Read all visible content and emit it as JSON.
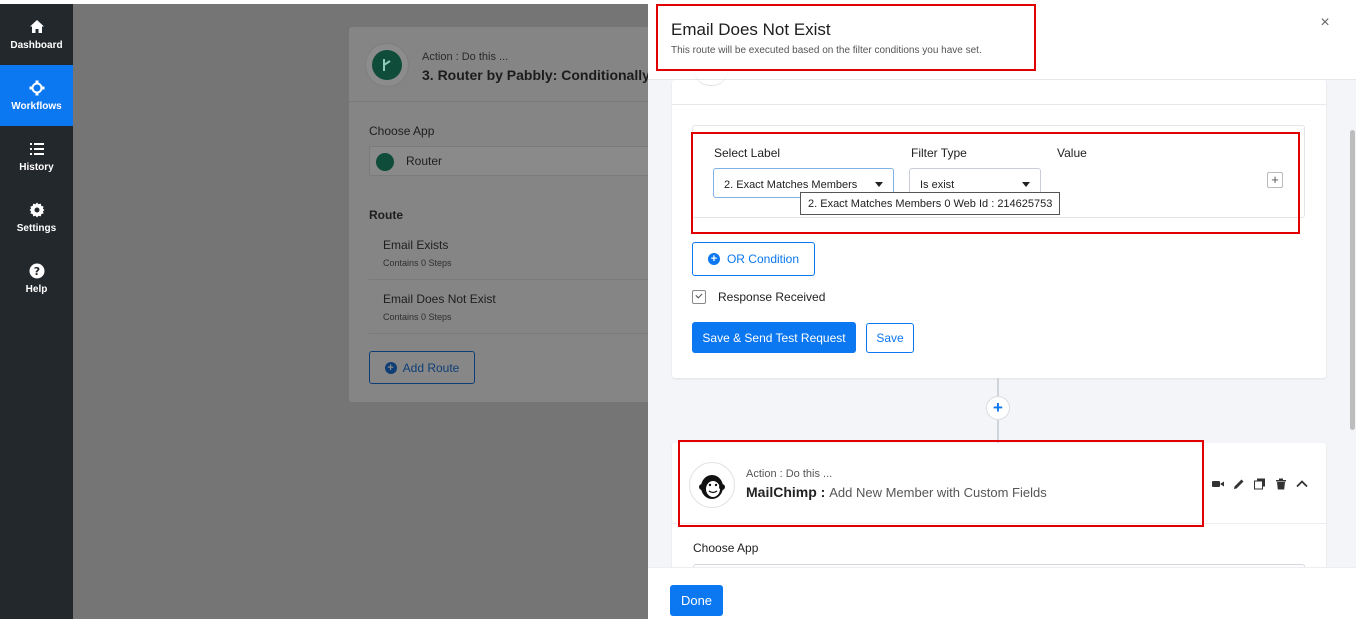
{
  "sidebar": {
    "items": [
      {
        "label": "Dashboard",
        "icon": "home-icon"
      },
      {
        "label": "Workflows",
        "icon": "workflow-icon",
        "active": true
      },
      {
        "label": "History",
        "icon": "list-icon"
      },
      {
        "label": "Settings",
        "icon": "gear-icon"
      },
      {
        "label": "Help",
        "icon": "help-icon"
      }
    ]
  },
  "background": {
    "action_label": "Action : Do this ...",
    "title": "3. Router by Pabbly: Conditionally",
    "choose_app_label": "Choose App",
    "app_value": "Router",
    "route_label": "Route",
    "routes": [
      {
        "name": "Email Exists",
        "steps": "Contains 0 Steps"
      },
      {
        "name": "Email Does Not Exist",
        "steps": "Contains 0 Steps"
      }
    ],
    "add_route": "Add Route"
  },
  "panel": {
    "title": "Email Does Not Exist",
    "subtitle": "This route will be executed based on the filter conditions you have set.",
    "close": "×",
    "filter": {
      "select_label_header": "Select Label",
      "filter_type_header": "Filter Type",
      "value_header": "Value",
      "select_label_value": "2. Exact Matches Members",
      "filter_type_value": "Is exist",
      "tooltip": "2. Exact Matches Members 0 Web Id : 214625753",
      "add": "+"
    },
    "or_condition": "OR Condition",
    "response_received": "Response Received",
    "save_send": "Save & Send Test Request",
    "save": "Save",
    "add_step": "+",
    "next_step": {
      "action_label": "Action : Do this ...",
      "app_name": "MailChimp :",
      "action_desc": "Add New Member with Custom Fields",
      "choose_app_label": "Choose App"
    },
    "done": "Done"
  },
  "colors": {
    "accent": "#0b77f0",
    "sidebar": "#23282d",
    "highlight": "#e00000"
  }
}
